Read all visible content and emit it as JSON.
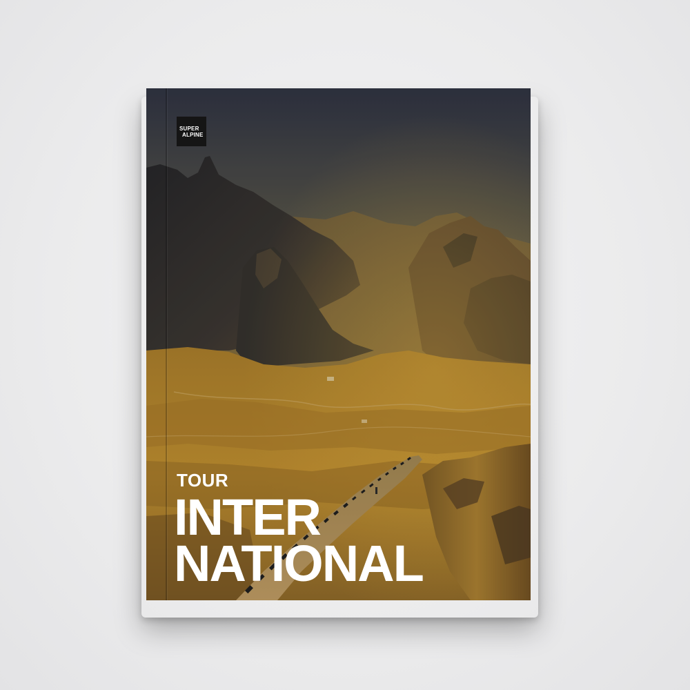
{
  "book": {
    "publisher_logo": {
      "line1": "SUPER",
      "line2": "ALPINE"
    },
    "title": {
      "kicker": "TOUR",
      "line1": "INTER",
      "line2": "NATIONAL"
    }
  },
  "colors": {
    "background": "#ececed",
    "sky_top": "#2f3340",
    "sky_bottom": "#9a8a55",
    "mountain_dark": "#2a2a2e",
    "terrain_gold": "#b8892a",
    "road": "#a98a52",
    "text": "#ffffff",
    "logo_bg": "#151515"
  }
}
